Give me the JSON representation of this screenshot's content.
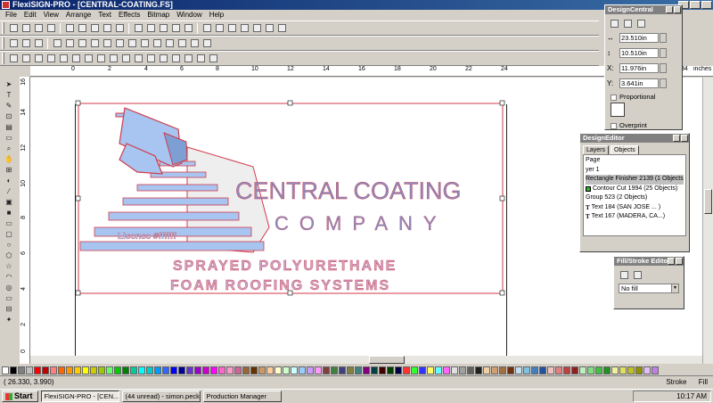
{
  "window": {
    "title": "FlexiSIGN-PRO - [CENTRAL-COATING.FS]"
  },
  "menu": [
    "File",
    "Edit",
    "View",
    "Arrange",
    "Text",
    "Effects",
    "Bitmap",
    "Window",
    "Help"
  ],
  "ruler": {
    "unit": "inches",
    "top_labels": [
      "0",
      "2",
      "4",
      "6",
      "8",
      "10",
      "12",
      "14",
      "16",
      "18",
      "20",
      "22",
      "24",
      "34"
    ],
    "left_labels": [
      "16",
      "14",
      "12",
      "10",
      "8",
      "6",
      "4",
      "2",
      "0"
    ]
  },
  "artwork": {
    "line1": "CENTRAL COATING",
    "line2": "COMPANY",
    "license": "Licence #ffffff",
    "tag1": "SPRAYED POLYURETHANE",
    "tag2": "FOAM ROOFING SYSTEMS",
    "fill_color": "#a7c5f0",
    "outline_color": "#d23a4a",
    "text_color": "#8a8cc0",
    "tag_color": "#c8a4c8"
  },
  "design_central": {
    "title": "DesignCentral",
    "width": "23.510in",
    "height": "10.510in",
    "x": "11.976in",
    "y": "3.641in",
    "proportional": "Proportional",
    "overprint": "Overprint"
  },
  "design_editor": {
    "title": "DesignEditor",
    "tabs": [
      "Layers",
      "Objects"
    ],
    "items": [
      "Page",
      "yer 1",
      "Rectangle Finisher 2139 (1 Objects)",
      "Contour Cut 1994 (25 Objects)",
      "Group 523 (2 Objects)",
      "Text 184 (SAN JOSE ... )",
      "Text 167 (MADERA, CA...)"
    ]
  },
  "fill_stroke": {
    "title": "Fill/Stroke Editor",
    "value": "No fill"
  },
  "status": {
    "coords": "( 26.330,  3.990)",
    "stroke": "Stroke",
    "fill": "Fill"
  },
  "taskbar": {
    "start": "Start",
    "items": [
      "FlexiSIGN-PRO - [CEN...",
      "(44 unread) - simon.peck...",
      "Production Manager"
    ],
    "clock": "10:17 AM"
  },
  "palette": [
    "#ffffff",
    "#000000",
    "#7f7f7f",
    "#c0c0c0",
    "#ff0000",
    "#c00000",
    "#ff8080",
    "#ff6600",
    "#ff9900",
    "#ffcc00",
    "#ffff00",
    "#cccc00",
    "#99cc00",
    "#66ff66",
    "#00cc00",
    "#008000",
    "#00cc99",
    "#00ffff",
    "#00cccc",
    "#0099ff",
    "#3366ff",
    "#0000ff",
    "#000099",
    "#6633cc",
    "#9900cc",
    "#cc00cc",
    "#ff00ff",
    "#ff66cc",
    "#ff99cc",
    "#cc6699",
    "#996633",
    "#663300",
    "#cc9966",
    "#ffcc99",
    "#ffffcc",
    "#ccffcc",
    "#ccffff",
    "#99ccff",
    "#cc99ff",
    "#ff99ff",
    "#804040",
    "#408040",
    "#404080",
    "#808040",
    "#408080",
    "#800080",
    "#004040",
    "#400000",
    "#004000",
    "#000040",
    "#ff3333",
    "#33ff33",
    "#3333ff",
    "#ffff66",
    "#66ffff",
    "#ff66ff",
    "#e0e0e0",
    "#a0a0a0",
    "#606060",
    "#202020",
    "#f0d0a0",
    "#d0a070",
    "#a07040",
    "#703010",
    "#c0e0f0",
    "#80c0e0",
    "#4080c0",
    "#2050a0",
    "#f0c0c0",
    "#e08080",
    "#c04040",
    "#902020",
    "#c0f0c0",
    "#80e080",
    "#40c040",
    "#209020",
    "#f0f0a0",
    "#e0e060",
    "#c0c020",
    "#909000",
    "#e0c0f0",
    "#c080e0"
  ]
}
